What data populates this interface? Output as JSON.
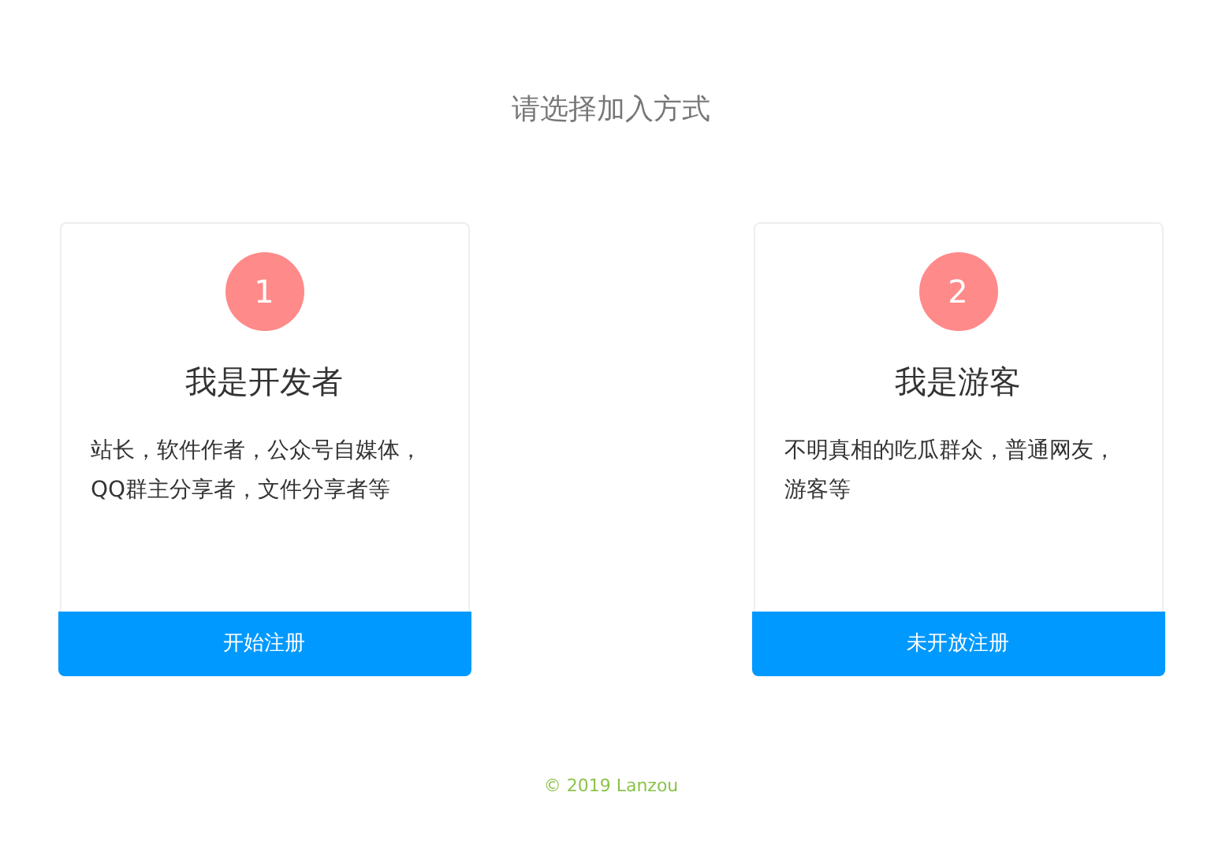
{
  "heading": "请选择加入方式",
  "cards": [
    {
      "number": "1",
      "title": "我是开发者",
      "description": "站长，软件作者，公众号自媒体，QQ群主分享者，文件分享者等",
      "button": "开始注册"
    },
    {
      "number": "2",
      "title": "我是游客",
      "description": "不明真相的吃瓜群众，普通网友，游客等",
      "button": "未开放注册"
    }
  ],
  "footer": "© 2019 Lanzou"
}
